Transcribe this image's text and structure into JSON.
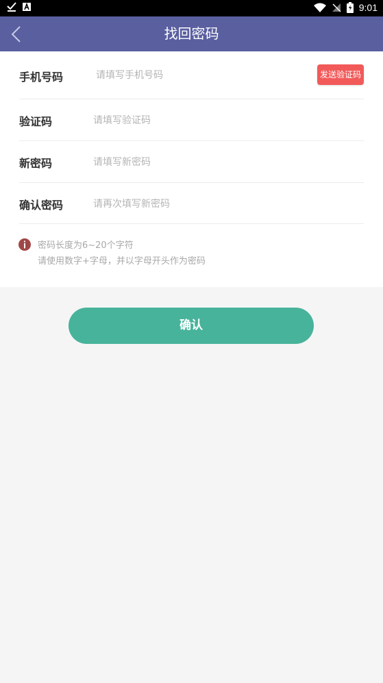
{
  "status_bar": {
    "time": "9:01",
    "icons": [
      "check-download-icon",
      "a-notification-icon",
      "wifi-icon",
      "no-signal-icon",
      "battery-charging-icon"
    ]
  },
  "header": {
    "title": "找回密码",
    "back_icon": "chevron-left-icon",
    "background_color": "#5a5fa0"
  },
  "form": {
    "phone": {
      "label": "手机号码",
      "placeholder": "请填写手机号码",
      "value": ""
    },
    "send_code_label": "发送验证码",
    "code": {
      "label": "验证码",
      "placeholder": "请填写验证码",
      "value": ""
    },
    "new_password": {
      "label": "新密码",
      "placeholder": "请填写新密码",
      "value": ""
    },
    "confirm_password": {
      "label": "确认密码",
      "placeholder": "请再次填写新密码",
      "value": ""
    }
  },
  "hint": {
    "icon": "info-icon",
    "line1": "密码长度为6~20个字符",
    "line2": "请使用数字+字母，并以字母开头作为密码"
  },
  "confirm_label": "确认",
  "colors": {
    "accent": "#47b39b",
    "send_code": "#f25a5a",
    "hint_icon": "#a04646"
  }
}
